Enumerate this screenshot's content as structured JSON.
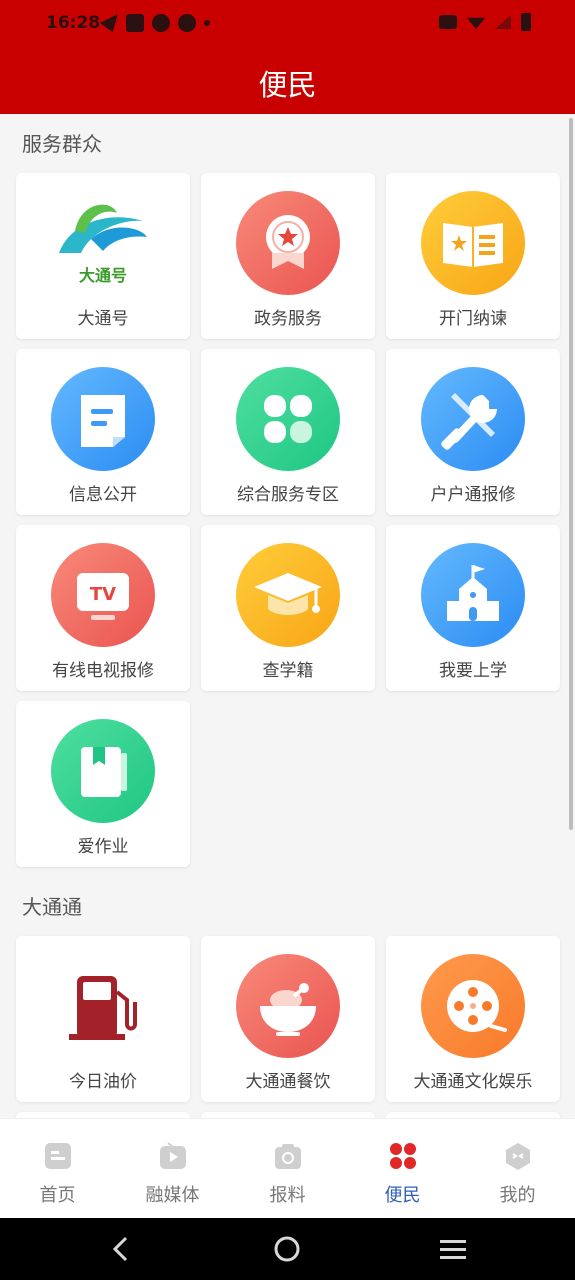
{
  "status_bar": {
    "time": "16:28"
  },
  "header": {
    "title": "便民"
  },
  "sections": [
    {
      "title": "服务群众",
      "items": [
        {
          "label": "大通号",
          "icon": "datonghao-logo"
        },
        {
          "label": "政务服务",
          "icon": "star-badge-icon"
        },
        {
          "label": "开门纳谏",
          "icon": "open-book-icon"
        },
        {
          "label": "信息公开",
          "icon": "document-icon"
        },
        {
          "label": "综合服务专区",
          "icon": "grid-clover-icon"
        },
        {
          "label": "户户通报修",
          "icon": "tools-icon"
        },
        {
          "label": "有线电视报修",
          "icon": "tv-icon"
        },
        {
          "label": "查学籍",
          "icon": "graduation-cap-icon"
        },
        {
          "label": "我要上学",
          "icon": "school-icon"
        },
        {
          "label": "爱作业",
          "icon": "notebook-icon"
        }
      ]
    },
    {
      "title": "大通通",
      "items": [
        {
          "label": "今日油价",
          "icon": "gas-pump-icon"
        },
        {
          "label": "大通通餐饮",
          "icon": "food-bowl-icon"
        },
        {
          "label": "大通通文化娱乐",
          "icon": "film-reel-icon"
        }
      ]
    }
  ],
  "datonghao_logo_text": "大通号",
  "tv_icon_text": "TV",
  "bottom_nav": [
    {
      "label": "首页",
      "icon": "home-icon",
      "active": false
    },
    {
      "label": "融媒体",
      "icon": "media-play-icon",
      "active": false
    },
    {
      "label": "报料",
      "icon": "camera-icon",
      "active": false
    },
    {
      "label": "便民",
      "icon": "clover-icon",
      "active": true
    },
    {
      "label": "我的",
      "icon": "profile-icon",
      "active": false
    }
  ],
  "colors": {
    "brand_red": "#c80000",
    "active_nav": "#2e5fb8",
    "inactive_nav": "#777777"
  }
}
